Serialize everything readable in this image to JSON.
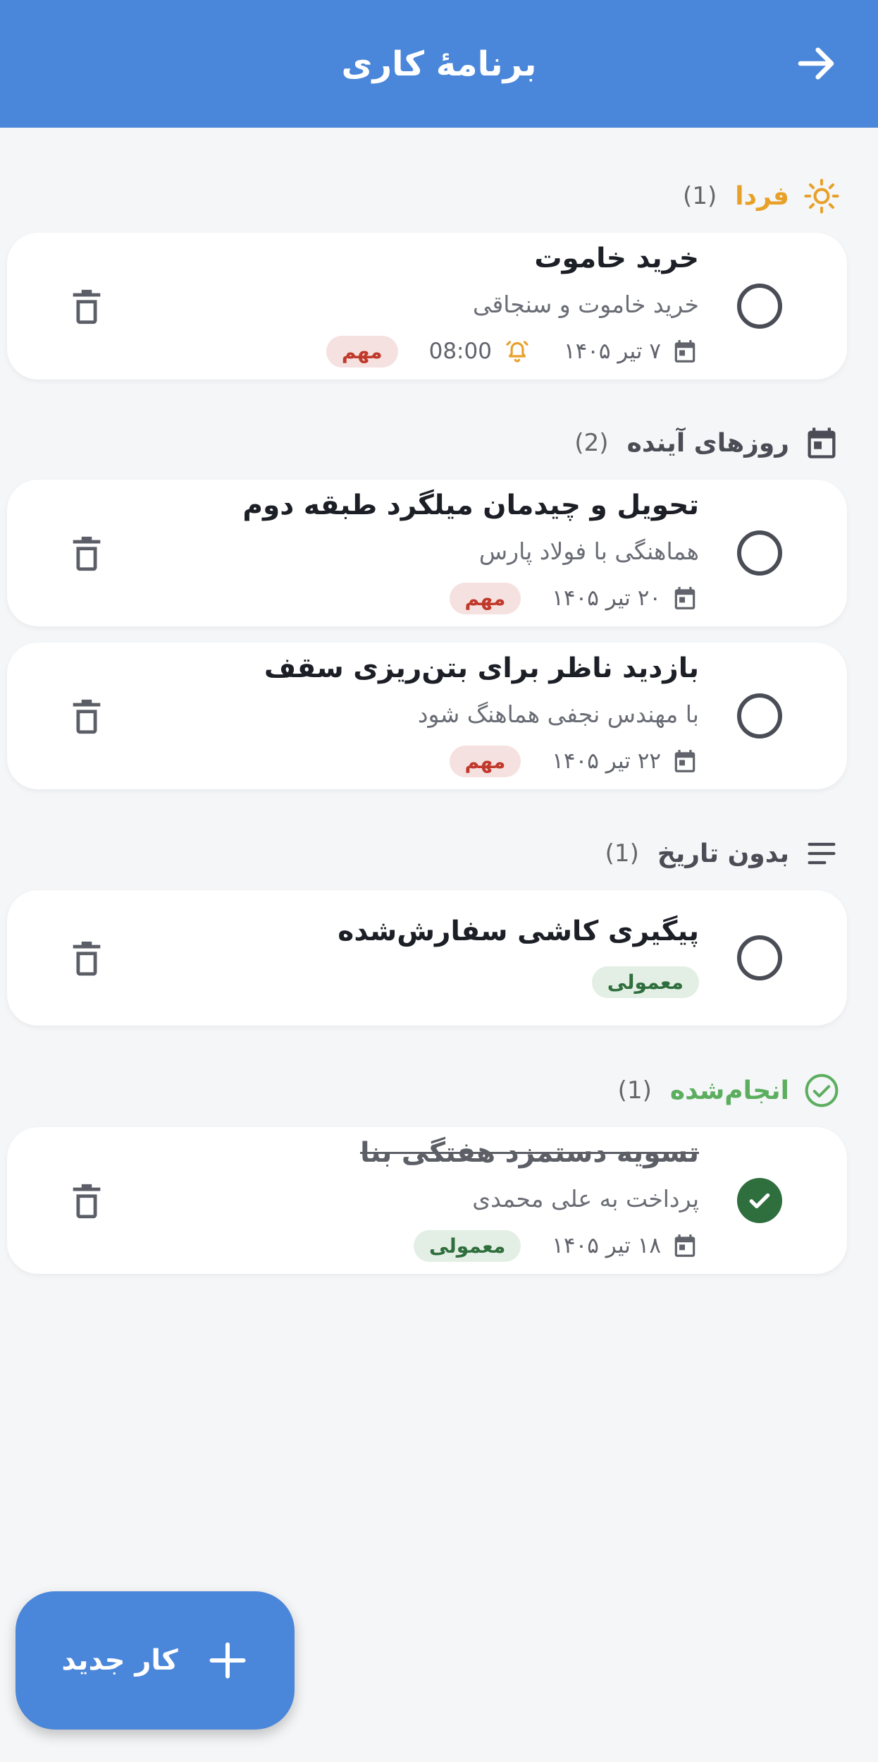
{
  "appbar": {
    "title": "برنامهٔ کاری",
    "back_icon": "arrow-right-icon"
  },
  "colors": {
    "primary": "#4a86d9",
    "tomorrow": "#e8a128",
    "upcoming": "#4a4d55",
    "done": "#5cae5f",
    "important_bg": "#f6e1e1",
    "important_text": "#c0392b",
    "normal_bg": "#e3efe5",
    "normal_text": "#2f6e3d"
  },
  "sections": {
    "tomorrow": {
      "title": "فردا",
      "count": "(1)",
      "icon": "sun-icon"
    },
    "upcoming": {
      "title": "روزهای آینده",
      "count": "(2)",
      "icon": "calendar-icon"
    },
    "nodate": {
      "title": "بدون تاریخ",
      "count": "(1)",
      "icon": "lines-icon"
    },
    "done": {
      "title": "انجام‌شده",
      "count": "(1)",
      "icon": "check-circle-icon"
    }
  },
  "tasks": [
    {
      "title": "خرید خاموت",
      "desc": "خرید خاموت و سنجاقی",
      "date": "۷ تیر ۱۴۰۵",
      "time": "08:00",
      "priority": "مهم"
    },
    {
      "title": "تحویل و چیدمان میلگرد طبقه دوم",
      "desc": "هماهنگی با فولاد پارس",
      "date": "۲۰ تیر ۱۴۰۵",
      "priority": "مهم"
    },
    {
      "title": "بازدید ناظر برای بتن‌ریزی سقف",
      "desc": "با مهندس نجفی هماهنگ شود",
      "date": "۲۲ تیر ۱۴۰۵",
      "priority": "مهم"
    },
    {
      "title": "پیگیری کاشی سفارش‌شده",
      "priority": "معمولی"
    },
    {
      "title": "تسویه دستمزد هفتگی بنا",
      "desc": "پرداخت به علی محمدی",
      "date": "۱۸ تیر ۱۴۰۵",
      "priority": "معمولی",
      "completed": true
    }
  ],
  "fab": {
    "label": "کار جدید",
    "icon": "plus-icon"
  }
}
